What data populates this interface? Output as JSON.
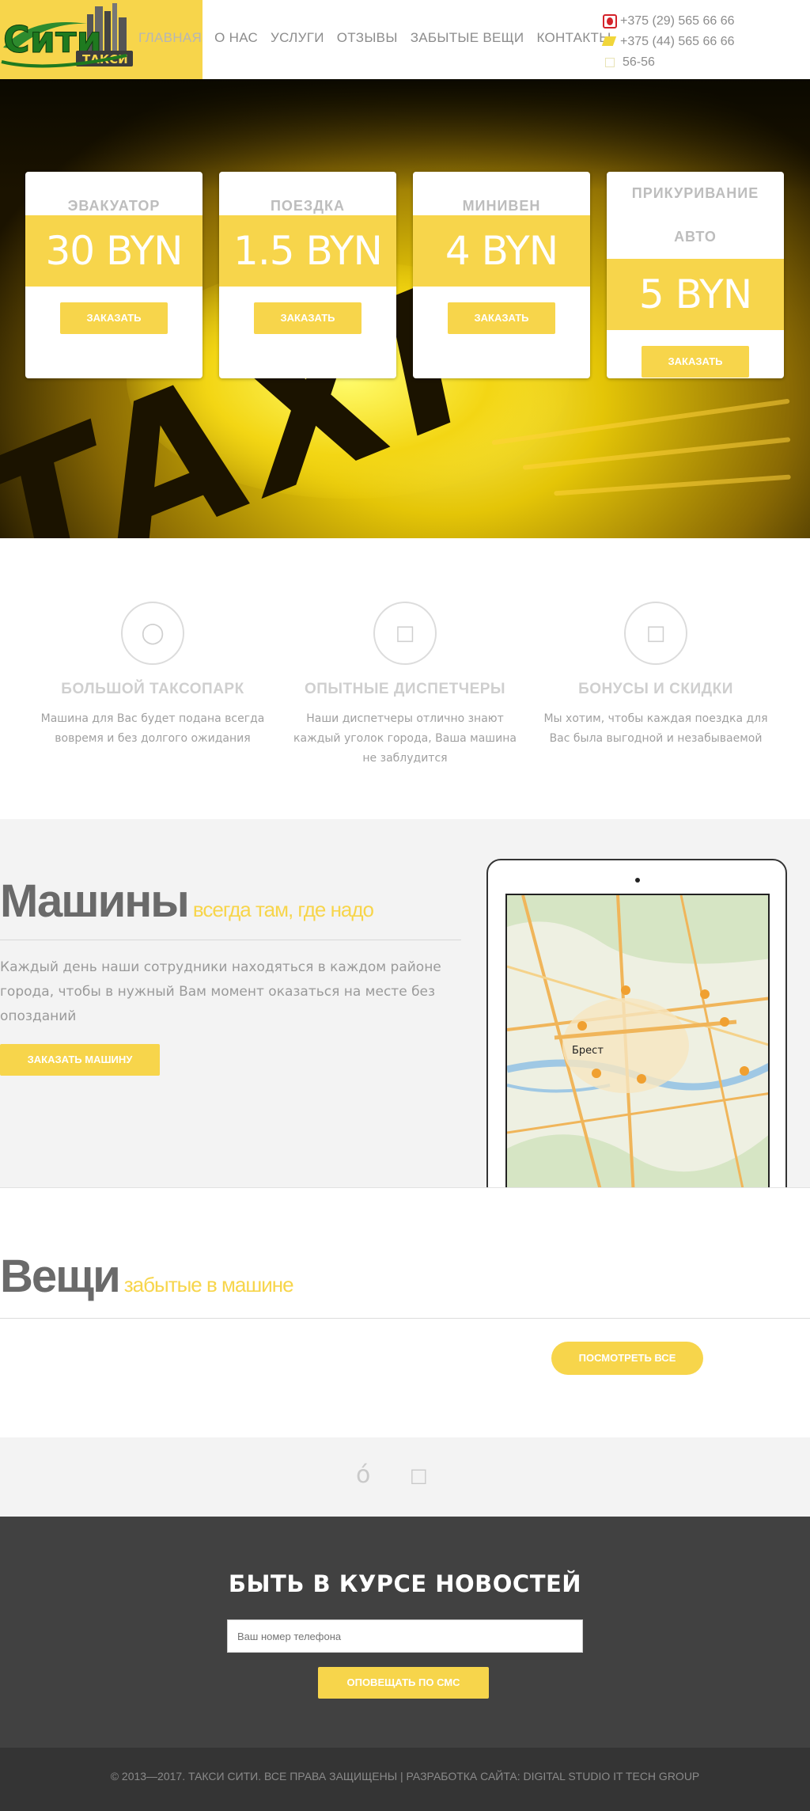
{
  "brand": {
    "logo_text": "Сити",
    "logo_sub": "ТАКСИ",
    "accent_color": "#f7d54b",
    "dark_color": "#414141"
  },
  "nav": {
    "items": [
      "ГЛАВНАЯ",
      "О НАС",
      "УСЛУГИ",
      "ОТЗЫВЫ",
      "ЗАБЫТЫЕ ВЕЩИ",
      "КОНТАКТЫ"
    ],
    "active": "ГЛАВНАЯ"
  },
  "phones": [
    {
      "operator_icon": "mts-icon",
      "number": "+375 (29) 565 66 66"
    },
    {
      "operator_icon": "velcom-icon",
      "number": "+375 (44) 565 66 66"
    },
    {
      "operator_icon": "city-phone-icon",
      "number": "56-56"
    }
  ],
  "hero": {
    "background_word": "TAXI",
    "cards": [
      {
        "title": "ЭВАКУАТОР",
        "price": "30 BYN",
        "button": "ЗАКАЗАТЬ"
      },
      {
        "title": "ПОЕЗДКА",
        "price": "1.5 BYN",
        "button": "ЗАКАЗАТЬ"
      },
      {
        "title": "МИНИВЕН",
        "price": "4 BYN",
        "button": "ЗАКАЗАТЬ"
      },
      {
        "title_line1": "ПРИКУРИВАНИЕ",
        "title_line2": "АВТО",
        "price": "5 BYN",
        "button": "ЗАКАЗАТЬ"
      }
    ]
  },
  "features": [
    {
      "icon": "car-icon",
      "title": "БОЛЬШОЙ ТАКСОПАРК",
      "text": "Машина для Вас будет подана всегда вовремя и без долгого ожидания"
    },
    {
      "icon": "headset-icon",
      "title": "ОПЫТНЫЕ ДИСПЕТЧЕРЫ",
      "text": "Наши диспетчеры отлично знают каждый уголок города, Ваша машина не заблудится"
    },
    {
      "icon": "gift-icon",
      "title": "БОНУСЫ И СКИДКИ",
      "text": "Мы хотим, чтобы каждая поездка для Вас была выгодной и незабываемой"
    }
  ],
  "machines": {
    "title": "Машины",
    "subtitle": "всегда там, где надо",
    "text": "Каждый день наши сотрудники находяться в каждом районе города, чтобы в нужный Вам момент оказаться на месте без опозданий",
    "button": "ЗАКАЗАТЬ МАШИНУ",
    "map_city": "Брест"
  },
  "things": {
    "title": "Вещи",
    "subtitle": "забытые в машине",
    "button": "ПОСМОТРЕТЬ ВСЕ"
  },
  "social": {
    "icons": [
      "odnoklassniki-icon",
      "vk-icon"
    ]
  },
  "news": {
    "title": "БЫТЬ В КУРСЕ НОВОСТЕЙ",
    "placeholder": "Ваш номер телефона",
    "button": "ОПОВЕЩАТЬ ПО СМС"
  },
  "footer": {
    "copyright": "© 2013—2017. ТАКСИ СИТИ. ВСЕ ПРАВА ЗАЩИЩЕНЫ | РАЗРАБОТКА САЙТА: DIGITAL STUDIO IT TECH GROUP"
  }
}
